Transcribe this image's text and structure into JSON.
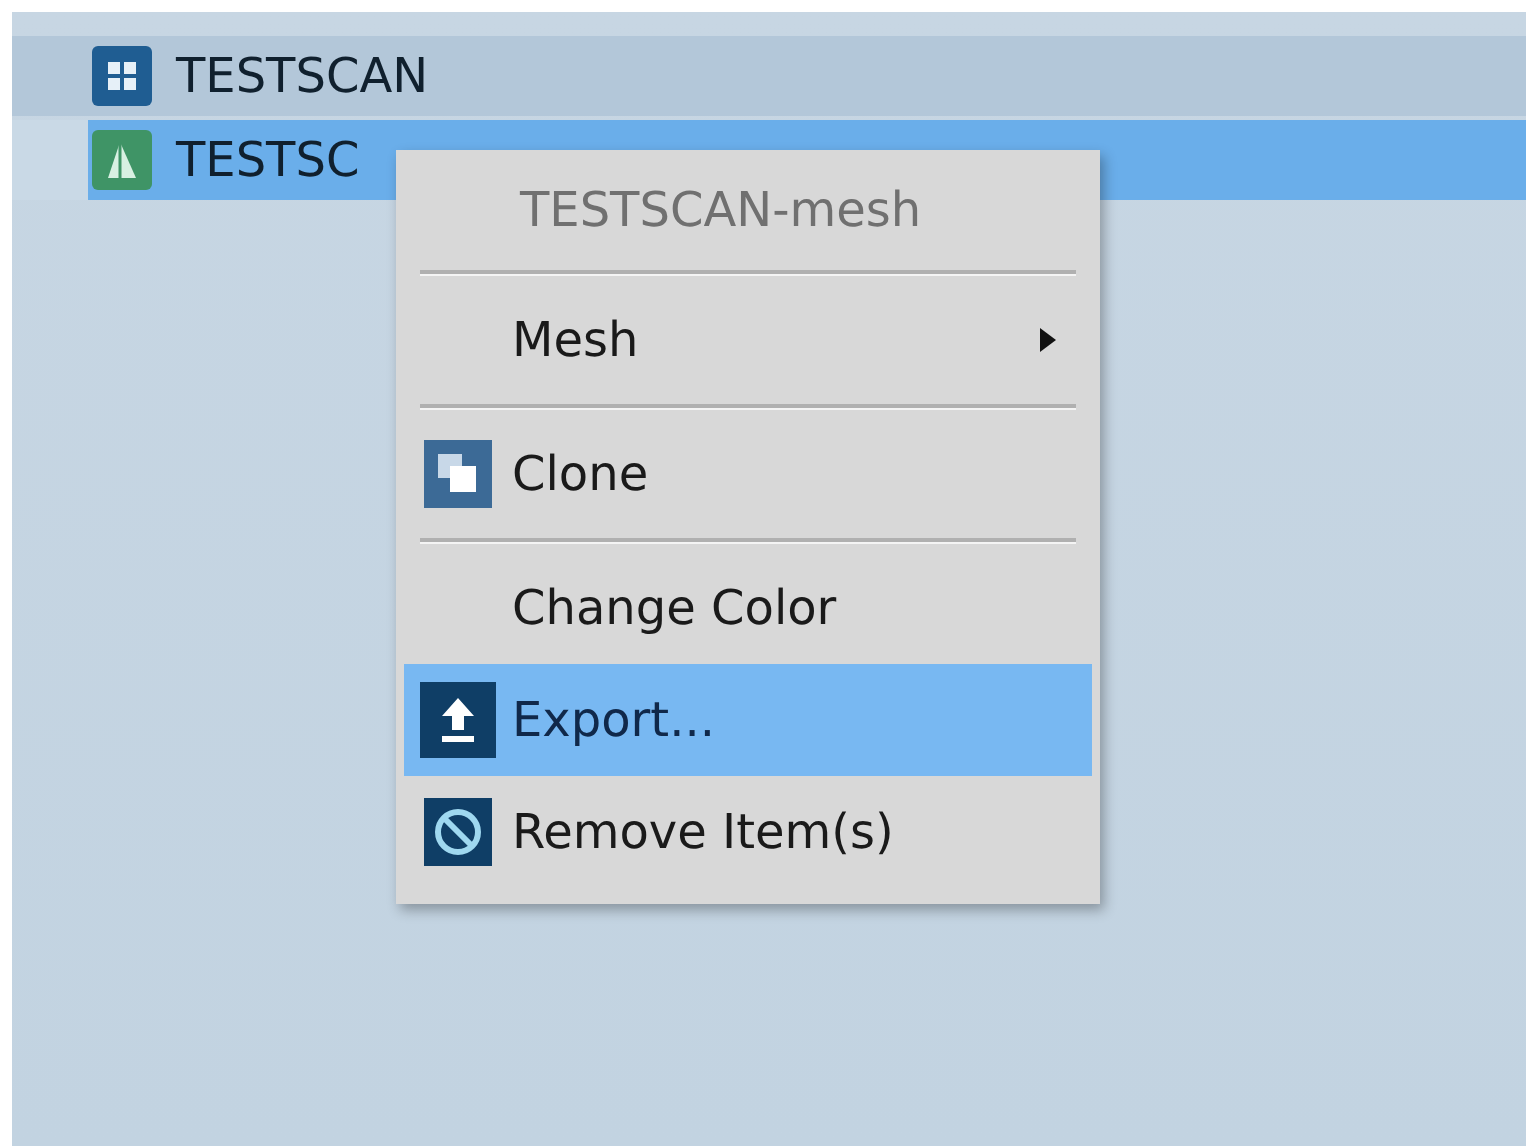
{
  "tree": {
    "items": [
      {
        "label": "TESTSCAN",
        "selected": false
      },
      {
        "label": "TESTSC",
        "selected": true
      }
    ]
  },
  "context_menu": {
    "title": "TESTSCAN-mesh",
    "items": [
      {
        "kind": "separator"
      },
      {
        "kind": "item",
        "label": "Mesh",
        "submenu": true,
        "selected": false
      },
      {
        "kind": "separator"
      },
      {
        "kind": "item",
        "label": "Clone",
        "selected": false
      },
      {
        "kind": "separator"
      },
      {
        "kind": "item",
        "label": "Change Color",
        "selected": false
      },
      {
        "kind": "item",
        "label": "Export...",
        "selected": true
      },
      {
        "kind": "item",
        "label": "Remove Item(s)",
        "selected": false
      }
    ]
  }
}
